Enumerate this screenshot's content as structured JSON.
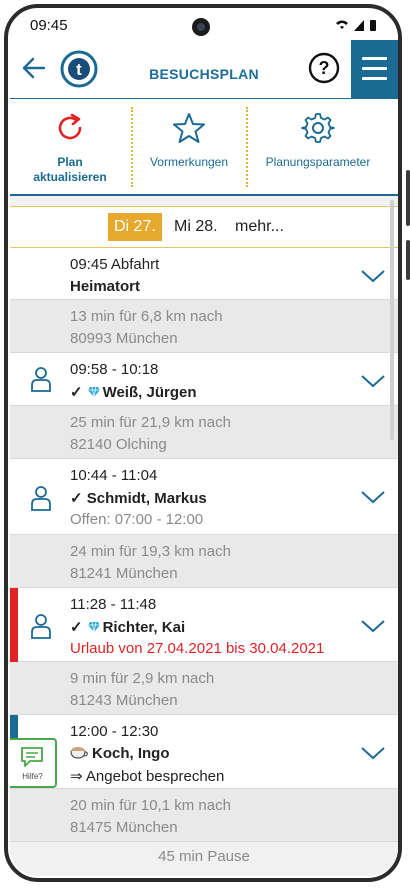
{
  "status": {
    "time": "09:45"
  },
  "appbar": {
    "title": "BESUCHSPLAN",
    "logo_letter": "t"
  },
  "toolbar": {
    "refresh_line1": "Plan",
    "refresh_line2": "aktualisieren",
    "favorites_label": "Vormerkungen",
    "settings_label": "Planungsparameter"
  },
  "days": {
    "selected": "Di 27.",
    "next": "Mi 28.",
    "more": "mehr..."
  },
  "rows": {
    "start": {
      "line1": "09:45 Abfahrt",
      "line2": "Heimatort"
    },
    "gap1": {
      "line1": "13 min für 6,8 km nach",
      "line2": "80993 München"
    },
    "visit1": {
      "line1": "09:58 - 10:18",
      "check": "✓",
      "name": "Weiß, Jürgen"
    },
    "gap2": {
      "line1": "25 min für 21,9 km nach",
      "line2": "82140 Olching"
    },
    "visit2": {
      "line1": "10:44 - 11:04",
      "check": "✓",
      "name": "Schmidt, Markus",
      "line3": "Offen: 07:00 - 12:00"
    },
    "gap3": {
      "line1": "24 min für 19,3 km nach",
      "line2": "81241 München"
    },
    "visit3": {
      "line1": "11:28 - 11:48",
      "check": "✓",
      "name": "Richter, Kai",
      "line3": "Urlaub von 27.04.2021 bis 30.04.2021"
    },
    "gap4": {
      "line1": "9 min für 2,9 km nach",
      "line2": "81243 München"
    },
    "visit4": {
      "line1": "12:00 - 12:30",
      "name": "Koch, Ingo",
      "line3": "⇒ Angebot besprechen"
    },
    "gap5": {
      "line1": "20 min für 10,1 km nach",
      "line2": "81475 München"
    },
    "pause": "45 min Pause"
  },
  "hilfe": {
    "label": "Hilfe?"
  },
  "colors": {
    "brand": "#1a6a93",
    "accent": "#e6a92d",
    "alert": "#e02424",
    "help": "#4aa64a"
  }
}
